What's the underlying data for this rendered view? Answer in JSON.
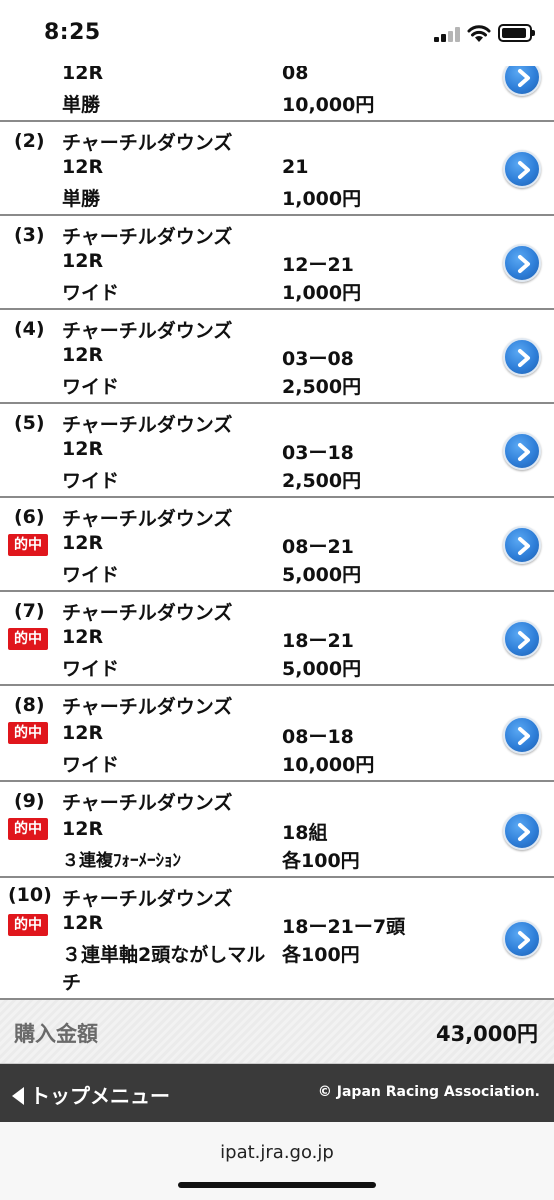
{
  "status_bar": {
    "time": "8:25"
  },
  "rows": [
    {
      "num": "",
      "venue": "",
      "race": "12R",
      "bet_type": "単勝",
      "combo": "08",
      "amount": "10,000円",
      "hit": false,
      "hit_label": ""
    },
    {
      "num": "(2)",
      "venue": "チャーチルダウンズ",
      "race": "12R",
      "bet_type": "単勝",
      "combo": "21",
      "amount": "1,000円",
      "hit": false,
      "hit_label": ""
    },
    {
      "num": "(3)",
      "venue": "チャーチルダウンズ",
      "race": "12R",
      "bet_type": "ワイド",
      "combo": "12ー21",
      "amount": "1,000円",
      "hit": false,
      "hit_label": ""
    },
    {
      "num": "(4)",
      "venue": "チャーチルダウンズ",
      "race": "12R",
      "bet_type": "ワイド",
      "combo": "03ー08",
      "amount": "2,500円",
      "hit": false,
      "hit_label": ""
    },
    {
      "num": "(5)",
      "venue": "チャーチルダウンズ",
      "race": "12R",
      "bet_type": "ワイド",
      "combo": "03ー18",
      "amount": "2,500円",
      "hit": false,
      "hit_label": ""
    },
    {
      "num": "(6)",
      "venue": "チャーチルダウンズ",
      "race": "12R",
      "bet_type": "ワイド",
      "combo": "08ー21",
      "amount": "5,000円",
      "hit": true,
      "hit_label": "的中"
    },
    {
      "num": "(7)",
      "venue": "チャーチルダウンズ",
      "race": "12R",
      "bet_type": "ワイド",
      "combo": "18ー21",
      "amount": "5,000円",
      "hit": true,
      "hit_label": "的中"
    },
    {
      "num": "(8)",
      "venue": "チャーチルダウンズ",
      "race": "12R",
      "bet_type": "ワイド",
      "combo": "08ー18",
      "amount": "10,000円",
      "hit": true,
      "hit_label": "的中"
    },
    {
      "num": "(9)",
      "venue": "チャーチルダウンズ",
      "race": "12R",
      "bet_type": "３連複ﾌｫｰﾒｰｼｮﾝ",
      "combo": "18組",
      "amount": "各100円",
      "hit": true,
      "hit_label": "的中"
    },
    {
      "num": "(10)",
      "venue": "チャーチルダウンズ",
      "race": "12R",
      "bet_type": "３連単軸2頭ながしマル",
      "bet_type_cont": "チ",
      "combo": "18ー21ー7頭",
      "amount": "各100円",
      "hit": true,
      "hit_label": "的中"
    }
  ],
  "total": {
    "label": "購入金額",
    "value": "43,000円"
  },
  "footer": {
    "top_menu": "トップメニュー",
    "copyright": "© Japan Racing Association."
  },
  "browser": {
    "url": "ipat.jra.go.jp"
  },
  "colors": {
    "hit_badge": "#e0161c",
    "arrow_button": "#2f7fd9",
    "footer_bg": "#3a3a3a"
  }
}
